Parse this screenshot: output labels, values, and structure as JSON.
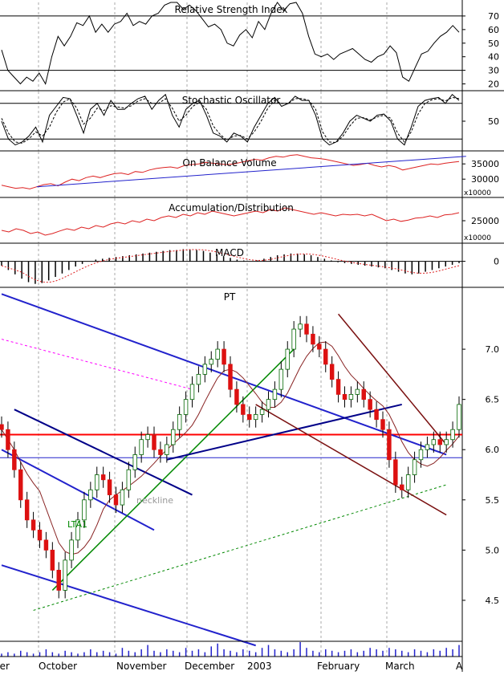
{
  "chart_data": [
    {
      "type": "line",
      "title": "Relative Strength Index",
      "y_ticks": [
        70,
        60,
        50,
        40,
        30,
        20
      ],
      "ylim": [
        15,
        80
      ],
      "reference_lines": [
        70,
        30
      ],
      "colors": {
        "line": "#000000"
      },
      "series": [
        {
          "values": [
            45,
            30,
            25,
            20,
            25,
            22,
            28,
            20,
            40,
            55,
            48,
            55,
            65,
            63,
            70,
            58,
            64,
            58,
            64,
            66,
            72,
            63,
            66,
            64,
            70,
            72,
            78,
            80,
            80,
            75,
            78,
            74,
            68,
            62,
            64,
            60,
            50,
            48,
            56,
            60,
            54,
            66,
            60,
            72,
            80,
            74,
            79,
            80,
            72,
            55,
            42,
            40,
            42,
            38,
            42,
            44,
            46,
            42,
            38,
            36,
            40,
            42,
            48,
            43,
            25,
            22,
            32,
            42,
            44,
            50,
            55,
            58,
            63,
            58
          ]
        }
      ]
    },
    {
      "type": "line",
      "title": "Stochastic Oscillator",
      "y_ticks": [
        50
      ],
      "ylim": [
        0,
        100
      ],
      "reference_lines": [
        80,
        20
      ],
      "colors": {
        "k": "#000000",
        "d": "#000000"
      },
      "series": [
        {
          "values": [
            50,
            20,
            10,
            15,
            25,
            40,
            15,
            60,
            75,
            90,
            88,
            60,
            30,
            70,
            80,
            60,
            85,
            70,
            70,
            80,
            88,
            92,
            70,
            85,
            95,
            60,
            40,
            70,
            80,
            85,
            60,
            30,
            25,
            15,
            30,
            25,
            15,
            40,
            60,
            80,
            90,
            75,
            80,
            92,
            85,
            85,
            60,
            20,
            10,
            15,
            30,
            50,
            60,
            55,
            50,
            60,
            62,
            50,
            20,
            10,
            40,
            75,
            85,
            88,
            90,
            80,
            95,
            85
          ]
        },
        {
          "values": [
            55,
            30,
            15,
            13,
            20,
            32,
            25,
            40,
            65,
            82,
            88,
            72,
            45,
            55,
            72,
            68,
            76,
            74,
            72,
            76,
            84,
            88,
            80,
            80,
            88,
            72,
            50,
            60,
            75,
            82,
            70,
            42,
            28,
            18,
            25,
            26,
            20,
            32,
            50,
            72,
            85,
            80,
            80,
            88,
            88,
            85,
            70,
            32,
            15,
            14,
            25,
            42,
            55,
            56,
            52,
            57,
            60,
            55,
            30,
            15,
            32,
            62,
            80,
            86,
            88,
            84,
            90,
            88
          ]
        }
      ]
    },
    {
      "type": "line",
      "title": "On Balance Volume",
      "y_ticks": [
        35000,
        30000
      ],
      "ylim": [
        24000,
        39000
      ],
      "axis_multiplier": "x10000",
      "colors": {
        "line": "#dd2222",
        "trend": "#2222cc"
      },
      "trendline": {
        "from": [
          5,
          27500
        ],
        "to": [
          66,
          37500
        ]
      },
      "series": [
        {
          "values": [
            28000,
            27500,
            27000,
            27200,
            26800,
            27500,
            28200,
            28500,
            27800,
            29000,
            30000,
            29500,
            30500,
            31000,
            30500,
            31200,
            31800,
            32000,
            31500,
            32500,
            32200,
            33000,
            33500,
            33800,
            34000,
            33600,
            34500,
            34800,
            35000,
            35500,
            35200,
            35000,
            34800,
            35000,
            35500,
            36000,
            36500,
            36200,
            37000,
            37500,
            37200,
            37800,
            38000,
            37500,
            37000,
            36800,
            36500,
            36000,
            35500,
            35000,
            34500,
            34800,
            35200,
            34500,
            34000,
            34500,
            34000,
            33000,
            33500,
            34000,
            34500,
            35000,
            34800,
            35200,
            35500,
            35800
          ]
        }
      ]
    },
    {
      "type": "line",
      "title": "Accumulation/Distribution",
      "y_ticks": [
        25000
      ],
      "ylim": [
        18000,
        32000
      ],
      "axis_multiplier": "x10000",
      "colors": {
        "line": "#dd2222"
      },
      "series": [
        {
          "values": [
            22000,
            21500,
            22500,
            22000,
            21000,
            21500,
            20500,
            21000,
            21800,
            22500,
            22000,
            23000,
            22500,
            23500,
            23000,
            24000,
            24500,
            24000,
            25000,
            24500,
            25500,
            25000,
            26000,
            26500,
            26000,
            27000,
            26500,
            27500,
            27000,
            28000,
            27500,
            27000,
            26500,
            27000,
            27500,
            28000,
            27500,
            28500,
            28000,
            29000,
            28500,
            28000,
            27500,
            27000,
            27500,
            27000,
            26500,
            27000,
            26800,
            27000,
            26500,
            27000,
            26000,
            25000,
            25500,
            24800,
            25200,
            25800,
            26000,
            26500,
            26000,
            26800,
            27000,
            27500
          ]
        }
      ]
    },
    {
      "type": "bar",
      "title": "MACD",
      "y_ticks": [
        0
      ],
      "ylim": [
        -0.3,
        0.2
      ],
      "colors": {
        "bars": "#000000",
        "signal": "#dd2222"
      },
      "values": [
        -0.05,
        -0.1,
        -0.15,
        -0.2,
        -0.24,
        -0.26,
        -0.25,
        -0.22,
        -0.18,
        -0.14,
        -0.1,
        -0.06,
        -0.03,
        0,
        0.02,
        0.03,
        0.04,
        0.05,
        0.06,
        0.07,
        0.08,
        0.09,
        0.1,
        0.11,
        0.12,
        0.13,
        0.13,
        0.14,
        0.14,
        0.13,
        0.12,
        0.1,
        0.08,
        0.06,
        0.04,
        0.02,
        0.01,
        0,
        0.01,
        0.03,
        0.05,
        0.07,
        0.08,
        0.09,
        0.09,
        0.08,
        0.07,
        0.05,
        0.03,
        0.01,
        -0.01,
        -0.02,
        -0.03,
        -0.04,
        -0.05,
        -0.06,
        -0.07,
        -0.08,
        -0.1,
        -0.12,
        -0.14,
        -0.15,
        -0.14,
        -0.12,
        -0.1,
        -0.08,
        -0.06,
        -0.04,
        -0.02
      ]
    },
    {
      "type": "candlestick",
      "title": "PT",
      "y_ticks": [
        7.0,
        6.5,
        6.0,
        5.5,
        5.0,
        4.5
      ],
      "ylim": [
        4.1,
        7.6
      ],
      "x_labels": [
        "ber",
        "October",
        "November",
        "December",
        "2003",
        "February",
        "March",
        "A"
      ],
      "annotations": [
        "neckline",
        "LTA1"
      ],
      "horizontal_lines": [
        6.15,
        5.92
      ],
      "colors": {
        "up": "#ffffff",
        "down": "#dd1111",
        "volume": "#2222cc",
        "ma": "#882222"
      },
      "closes": [
        6.2,
        6.0,
        5.8,
        5.5,
        5.3,
        5.2,
        5.1,
        5.0,
        4.8,
        4.6,
        4.9,
        5.1,
        5.3,
        5.5,
        5.6,
        5.75,
        5.7,
        5.55,
        5.45,
        5.6,
        5.8,
        5.95,
        6.1,
        6.15,
        6.0,
        5.95,
        6.05,
        6.2,
        6.35,
        6.5,
        6.65,
        6.75,
        6.85,
        6.9,
        7.0,
        6.85,
        6.6,
        6.45,
        6.35,
        6.3,
        6.35,
        6.4,
        6.5,
        6.6,
        6.8,
        7.0,
        7.2,
        7.25,
        7.15,
        7.05,
        7.0,
        6.85,
        6.7,
        6.55,
        6.5,
        6.55,
        6.6,
        6.5,
        6.4,
        6.3,
        6.2,
        5.9,
        5.65,
        5.6,
        5.75,
        5.9,
        6.0,
        6.05,
        6.1,
        6.05,
        6.1,
        6.2,
        6.45
      ],
      "volume": [
        0.2,
        0.3,
        0.2,
        0.4,
        0.3,
        0.2,
        0.3,
        0.5,
        0.3,
        0.2,
        0.4,
        0.3,
        0.2,
        0.3,
        0.5,
        0.3,
        0.4,
        0.3,
        0.2,
        0.6,
        0.4,
        0.3,
        0.5,
        0.8,
        0.4,
        0.3,
        0.5,
        0.4,
        0.3,
        0.6,
        0.4,
        0.5,
        0.3,
        0.7,
        0.9,
        0.5,
        0.4,
        0.3,
        0.5,
        0.4,
        0.3,
        0.6,
        0.8,
        0.5,
        0.4,
        0.3,
        0.5,
        1.0,
        0.6,
        0.4,
        0.3,
        0.5,
        0.4,
        0.3,
        0.4,
        0.5,
        0.3,
        0.4,
        0.6,
        0.5,
        0.4,
        0.6,
        0.5,
        0.4,
        0.3,
        0.5,
        0.4,
        0.3,
        0.5,
        0.4,
        0.6,
        0.5,
        0.8
      ]
    }
  ]
}
